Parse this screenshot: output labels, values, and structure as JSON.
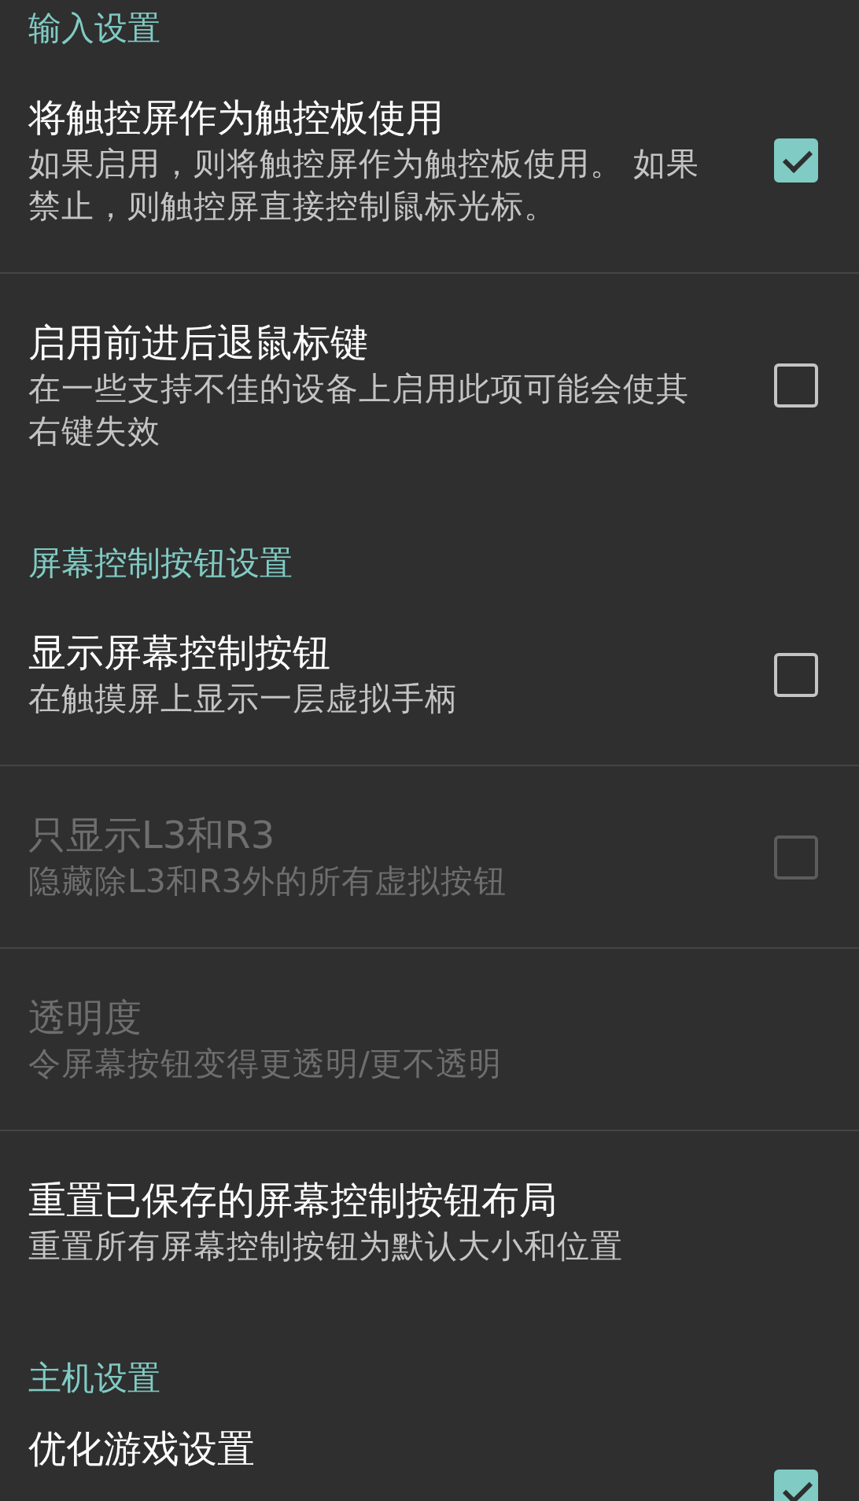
{
  "sections": [
    {
      "header": "输入设置",
      "items": [
        {
          "kind": "checkbox",
          "title": "将触控屏作为触控板使用",
          "summary": "如果启用，则将触控屏作为触控板使用。 如果禁止，则触控屏直接控制鼠标光标。",
          "checked": true,
          "disabled": false
        },
        {
          "kind": "checkbox",
          "title": "启用前进后退鼠标键",
          "summary": "在一些支持不佳的设备上启用此项可能会使其右键失效",
          "checked": false,
          "disabled": false
        }
      ]
    },
    {
      "header": "屏幕控制按钮设置",
      "items": [
        {
          "kind": "checkbox",
          "title": "显示屏幕控制按钮",
          "summary": "在触摸屏上显示一层虚拟手柄",
          "checked": false,
          "disabled": false
        },
        {
          "kind": "checkbox",
          "title": "只显示L3和R3",
          "summary": "隐藏除L3和R3外的所有虚拟按钮",
          "checked": false,
          "disabled": true
        },
        {
          "kind": "plain",
          "title": "透明度",
          "summary": "令屏幕按钮变得更透明/更不透明",
          "disabled": true
        },
        {
          "kind": "plain",
          "title": "重置已保存的屏幕控制按钮布局",
          "summary": "重置所有屏幕控制按钮为默认大小和位置",
          "disabled": false
        }
      ]
    },
    {
      "header": "主机设置",
      "items": [
        {
          "kind": "checkbox",
          "title": "优化游戏设置",
          "checked": true,
          "disabled": false
        }
      ]
    }
  ]
}
